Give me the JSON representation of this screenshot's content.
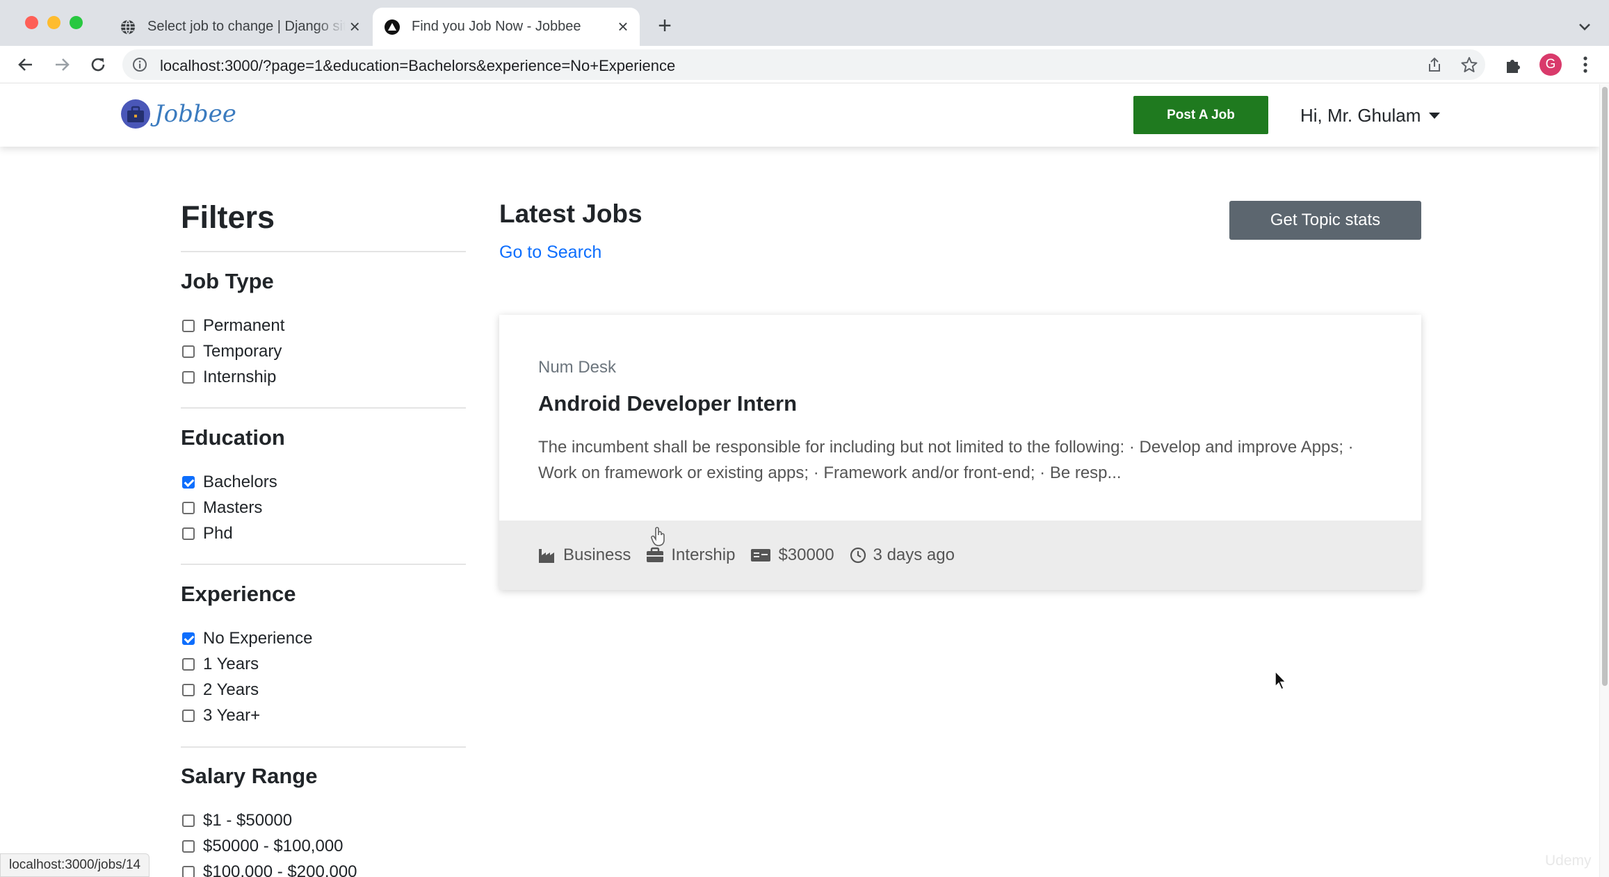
{
  "browser": {
    "tabs": [
      {
        "title": "Select job to change | Django site admin",
        "active": false,
        "icon": "globe-icon"
      },
      {
        "title": "Find you Job Now - Jobbee",
        "active": true,
        "icon": "triangle-logo-icon"
      }
    ],
    "url": "localhost:3000/?page=1&education=Bachelors&experience=No+Experience",
    "profile_initial": "G",
    "status_url": "localhost:3000/jobs/14"
  },
  "navbar": {
    "logo_text": "Jobbee",
    "post_job_label": "Post A Job",
    "user_greeting": "Hi, Mr. Ghulam"
  },
  "filters": {
    "title": "Filters",
    "job_type": {
      "heading": "Job Type",
      "options": [
        {
          "label": "Permanent",
          "checked": false
        },
        {
          "label": "Temporary",
          "checked": false
        },
        {
          "label": "Internship",
          "checked": false
        }
      ]
    },
    "education": {
      "heading": "Education",
      "options": [
        {
          "label": "Bachelors",
          "checked": true
        },
        {
          "label": "Masters",
          "checked": false
        },
        {
          "label": "Phd",
          "checked": false
        }
      ]
    },
    "experience": {
      "heading": "Experience",
      "options": [
        {
          "label": "No Experience",
          "checked": true
        },
        {
          "label": "1 Years",
          "checked": false
        },
        {
          "label": "2 Years",
          "checked": false
        },
        {
          "label": "3 Year+",
          "checked": false
        }
      ]
    },
    "salary": {
      "heading": "Salary Range",
      "options": [
        {
          "label": "$1 - $50000",
          "checked": false
        },
        {
          "label": "$50000 - $100,000",
          "checked": false
        },
        {
          "label": "$100,000 - $200,000",
          "checked": false
        }
      ]
    }
  },
  "main": {
    "title": "Latest Jobs",
    "search_link": "Go to Search",
    "topic_stats_label": "Get Topic stats",
    "jobs": [
      {
        "company": "Num Desk",
        "title": "Android Developer Intern",
        "description": "The incumbent shall be responsible for including but not limited to the following: · Develop and improve Apps; · Work on framework or existing apps; · Framework and/or front-end; · Be resp...",
        "industry": "Business",
        "job_type": "Intership",
        "salary": "$30000",
        "posted": "3 days ago"
      }
    ]
  },
  "watermark": "Udemy",
  "colors": {
    "post_job_green": "#1f7a1f",
    "link_blue": "#0d6efd",
    "stats_button_gray": "#5c666f",
    "checkbox_checked": "#0d6efd"
  }
}
